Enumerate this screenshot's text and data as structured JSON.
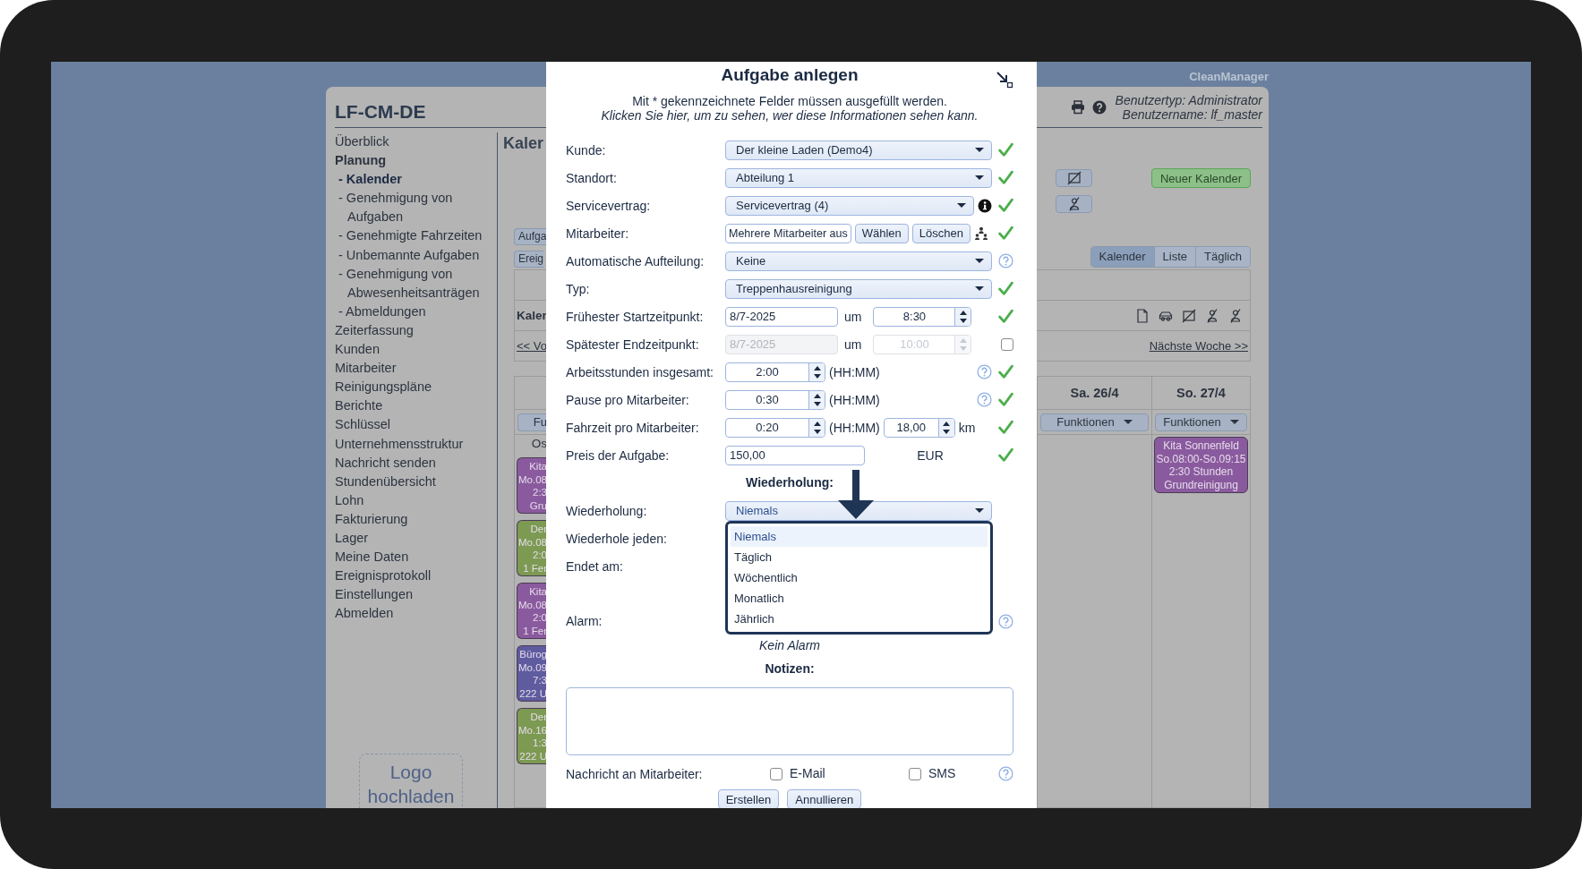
{
  "brand": "CleanManager",
  "app": {
    "title": "LF-CM-DE",
    "user_type": "Benutzertyp: Administrator",
    "user_name": "Benutzername: lf_master",
    "sidebar": {
      "items": [
        {
          "label": "Überblick",
          "selected": false
        },
        {
          "label": "Planung",
          "selected": false,
          "children": [
            {
              "label": "- Kalender",
              "selected": true
            },
            {
              "label": "- Genehmigung von Aufgaben",
              "selected": false
            },
            {
              "label": "- Genehmigte Fahrzeiten",
              "selected": false
            },
            {
              "label": "- Unbemannte Aufgaben",
              "selected": false
            },
            {
              "label": "- Genehmigung von Abwesenheitsanträgen",
              "selected": false
            },
            {
              "label": "- Abmeldungen",
              "selected": false
            }
          ]
        },
        {
          "label": "Zeiterfassung",
          "selected": false
        },
        {
          "label": "Kunden",
          "selected": false
        },
        {
          "label": "Mitarbeiter",
          "selected": false
        },
        {
          "label": "Reinigungspläne",
          "selected": false
        },
        {
          "label": "Berichte",
          "selected": false
        },
        {
          "label": "Schlüssel",
          "selected": false
        },
        {
          "label": "Unternehmensstruktur",
          "selected": false
        },
        {
          "label": "Nachricht senden",
          "selected": false
        },
        {
          "label": "Stundenübersicht",
          "selected": false
        },
        {
          "label": "Lohn",
          "selected": false
        },
        {
          "label": "Fakturierung",
          "selected": false
        },
        {
          "label": "Lager",
          "selected": false
        },
        {
          "label": "Meine Daten",
          "selected": false
        },
        {
          "label": "Ereignisprotokoll",
          "selected": false
        },
        {
          "label": "Einstellungen",
          "selected": false
        },
        {
          "label": "Abmelden",
          "selected": false
        }
      ],
      "logo_upload": "Logo hochladen"
    },
    "calendar": {
      "heading": "Kaler",
      "new_calendar": "Neuer Kalender",
      "side_buttons": [
        "Aufga",
        "Ereig"
      ],
      "view_tabs": [
        {
          "label": "Kalender",
          "selected": true
        },
        {
          "label": "Liste",
          "selected": false
        },
        {
          "label": "Täglich",
          "selected": false
        }
      ],
      "week_title": "Kaler",
      "prev_link": "<< Vo",
      "next_link": "Nächste Woche >>",
      "days": [
        {
          "kind": "partial",
          "functions": "Fu",
          "note": "Os",
          "events": [
            {
              "lines": [
                "Kita",
                "Mo.08",
                "2:3",
                "Gru"
              ],
              "color": "#8a5a9e"
            },
            {
              "lines": [
                "Der",
                "Mo.08",
                "2:0",
                "1 Fer"
              ],
              "color": "#7c9a52"
            },
            {
              "lines": [
                "Kita",
                "Mo.08",
                "2:0",
                "1 Fer"
              ],
              "color": "#8a5a9e"
            },
            {
              "lines": [
                "Bürog",
                "Mo.09",
                "7:3",
                "222 U"
              ],
              "color": "#5e5b9f"
            },
            {
              "lines": [
                "Der",
                "Mo.16",
                "1:3",
                "222 U"
              ],
              "color": "#7c9a52"
            }
          ]
        },
        {
          "kind": "full",
          "header": "Sa. 26/4",
          "functions": "Funktionen"
        },
        {
          "kind": "full",
          "header": "So. 27/4",
          "functions": "Funktionen",
          "events": [
            {
              "lines": [
                "Kita Sonnenfeld",
                "So.08:00-So.09:15",
                "2:30 Stunden",
                "Grundreinigung"
              ],
              "color": "#8a5a9e"
            }
          ]
        }
      ]
    }
  },
  "dialog": {
    "title": "Aufgabe anlegen",
    "note": "Mit * gekennzeichnete Felder müssen ausgefüllt werden.",
    "info_link": "Klicken Sie hier, um zu sehen, wer diese Informationen sehen kann.",
    "fields": [
      {
        "kind": "select",
        "label": "Kunde:",
        "value": "Der kleine Laden (Demo4)",
        "valid": true
      },
      {
        "kind": "select",
        "label": "Standort:",
        "value": "Abteilung 1",
        "valid": true
      },
      {
        "kind": "select",
        "label": "Servicevertrag:",
        "value": "Servicevertrag (4)",
        "info": true,
        "valid": true
      },
      {
        "kind": "employees",
        "label": "Mitarbeiter:",
        "value": "Mehrere Mitarbeiter aus",
        "buttons": [
          "Wählen",
          "Löschen"
        ],
        "valid": true
      },
      {
        "kind": "select",
        "label": "Automatische Aufteilung:",
        "value": "Keine",
        "help": true,
        "valid": false
      },
      {
        "kind": "select",
        "label": "Typ:",
        "value": "Treppenhausreinigung",
        "valid": true
      },
      {
        "kind": "datetime",
        "label": "Frühester Startzeitpunkt:",
        "date": "8/7-2025",
        "at": "um",
        "time": "8:30",
        "valid": true
      },
      {
        "kind": "optional_datetime",
        "label": "Spätester Endzeitpunkt:",
        "date": "8/7-2025",
        "at": "um",
        "time": "10:00",
        "enabled": false
      },
      {
        "kind": "duration",
        "label": "Arbeitsstunden insgesamt:",
        "value": "2:00",
        "unit": "(HH:MM)",
        "help": true,
        "valid": true
      },
      {
        "kind": "duration",
        "label": "Pause pro Mitarbeiter:",
        "value": "0:30",
        "unit": "(HH:MM)",
        "help": true,
        "valid": true
      },
      {
        "kind": "travel",
        "label": "Fahrzeit pro Mitarbeiter:",
        "value": "0:20",
        "unit": "(HH:MM)",
        "distance": "18,00",
        "distance_unit": "km",
        "valid": true
      },
      {
        "kind": "price",
        "label": "Preis der Aufgabe:",
        "value": "150,00",
        "currency": "EUR",
        "valid": true
      },
      {
        "kind": "heading",
        "label": "Wiederholung:"
      },
      {
        "kind": "select",
        "label": "Wiederholung:",
        "value": "Niemals",
        "open": true,
        "options": [
          {
            "label": "Niemals",
            "selected": true
          },
          {
            "label": "Täglich",
            "selected": false
          },
          {
            "label": "Wöchentlich",
            "selected": false
          },
          {
            "label": "Monatlich",
            "selected": false
          },
          {
            "label": "Jährlich",
            "selected": false
          }
        ]
      },
      {
        "kind": "label",
        "label": "Wiederhole jeden:"
      },
      {
        "kind": "label",
        "label": "Endet am:"
      },
      {
        "kind": "alarm",
        "label": "Alarm:",
        "help": true,
        "summary": "Kein Alarm"
      }
    ],
    "notes": {
      "heading": "Notizen:"
    },
    "notify": {
      "label": "Nachricht an Mitarbeiter:",
      "channels": [
        {
          "label": "E-Mail",
          "checked": false
        },
        {
          "label": "SMS",
          "checked": false
        }
      ],
      "help": true
    },
    "buttons": [
      "Erstellen",
      "Annullieren"
    ]
  }
}
